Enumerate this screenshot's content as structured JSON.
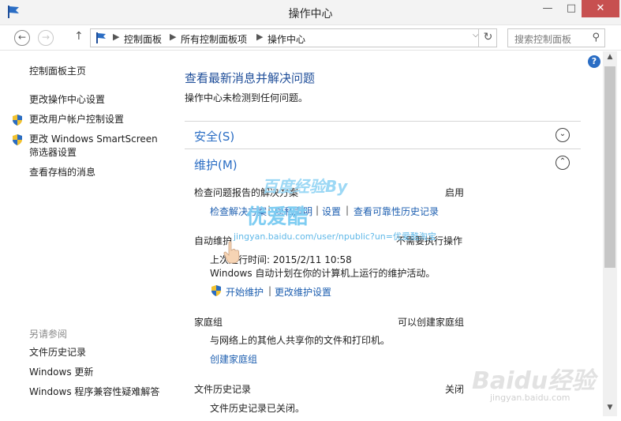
{
  "window": {
    "title": "操作中心",
    "close_glyph": "✕",
    "minimize_glyph": "—",
    "maximize_glyph": "□"
  },
  "nav": {
    "back_glyph": "←",
    "forward_glyph": "→",
    "up_glyph": "↑",
    "breadcrumb": [
      "控制面板",
      "所有控制面板项",
      "操作中心"
    ],
    "sep_glyph": "▶",
    "dropdown_glyph": "⌵",
    "refresh_glyph": "↻",
    "search_placeholder": "搜索控制面板",
    "search_glyph": "⚲"
  },
  "sidebar": {
    "home": "控制面板主页",
    "items": [
      {
        "label": "更改操作中心设置",
        "icon": "none"
      },
      {
        "label": "更改用户帐户控制设置",
        "icon": "uac-shield-icon"
      },
      {
        "label": "更改 Windows SmartScreen",
        "label2": "筛选器设置",
        "icon": "uac-shield-icon"
      },
      {
        "label": "查看存档的消息",
        "icon": "none"
      }
    ],
    "see_also_title": "另请参阅",
    "see_also": [
      "文件历史记录",
      "Windows 更新",
      "Windows 程序兼容性疑难解答"
    ]
  },
  "main": {
    "title": "查看最新消息并解决问题",
    "subtitle": "操作中心未检测到任何问题。",
    "security": {
      "title": "安全(S)",
      "glyph": "⌄"
    },
    "maintenance": {
      "title": "维护(M)",
      "glyph": "⌃",
      "problem_reports": {
        "label": "检查问题报告的解决方案",
        "status": "启用",
        "links": [
          "检查解决方案",
          "隐私声明",
          "设置",
          "查看可靠性历史记录"
        ],
        "sep": "|"
      },
      "auto_maintenance": {
        "label": "自动维护",
        "status": "不需要执行操作",
        "last_run": "上次运行时间: 2015/2/11 10:58",
        "desc": "Windows 自动计划在你的计算机上运行的维护活动。",
        "links": [
          "开始维护",
          "更改维护设置"
        ],
        "sep": "|"
      },
      "homegroup": {
        "label": "家庭组",
        "status": "可以创建家庭组",
        "desc": "与网络上的其他人共享你的文件和打印机。",
        "link": "创建家庭组"
      },
      "file_history": {
        "label": "文件历史记录",
        "status": "关闭",
        "desc": "文件历史记录已关闭。"
      }
    },
    "help_glyph": "?"
  },
  "scrollbar": {
    "up_glyph": "▲",
    "down_glyph": "▼"
  },
  "watermarks": {
    "baidu": "Baidu经验",
    "baidu_url": "jingyan.baidu.com",
    "overlay_top": "百度经验By",
    "overlay_mid": "优爱酷",
    "overlay_url": "jingyan.baidu.com/user/npublic?un=优爱酷淘宝"
  },
  "colors": {
    "link": "#1e5fb0",
    "heading": "#1f4e99",
    "close": "#c75050"
  }
}
